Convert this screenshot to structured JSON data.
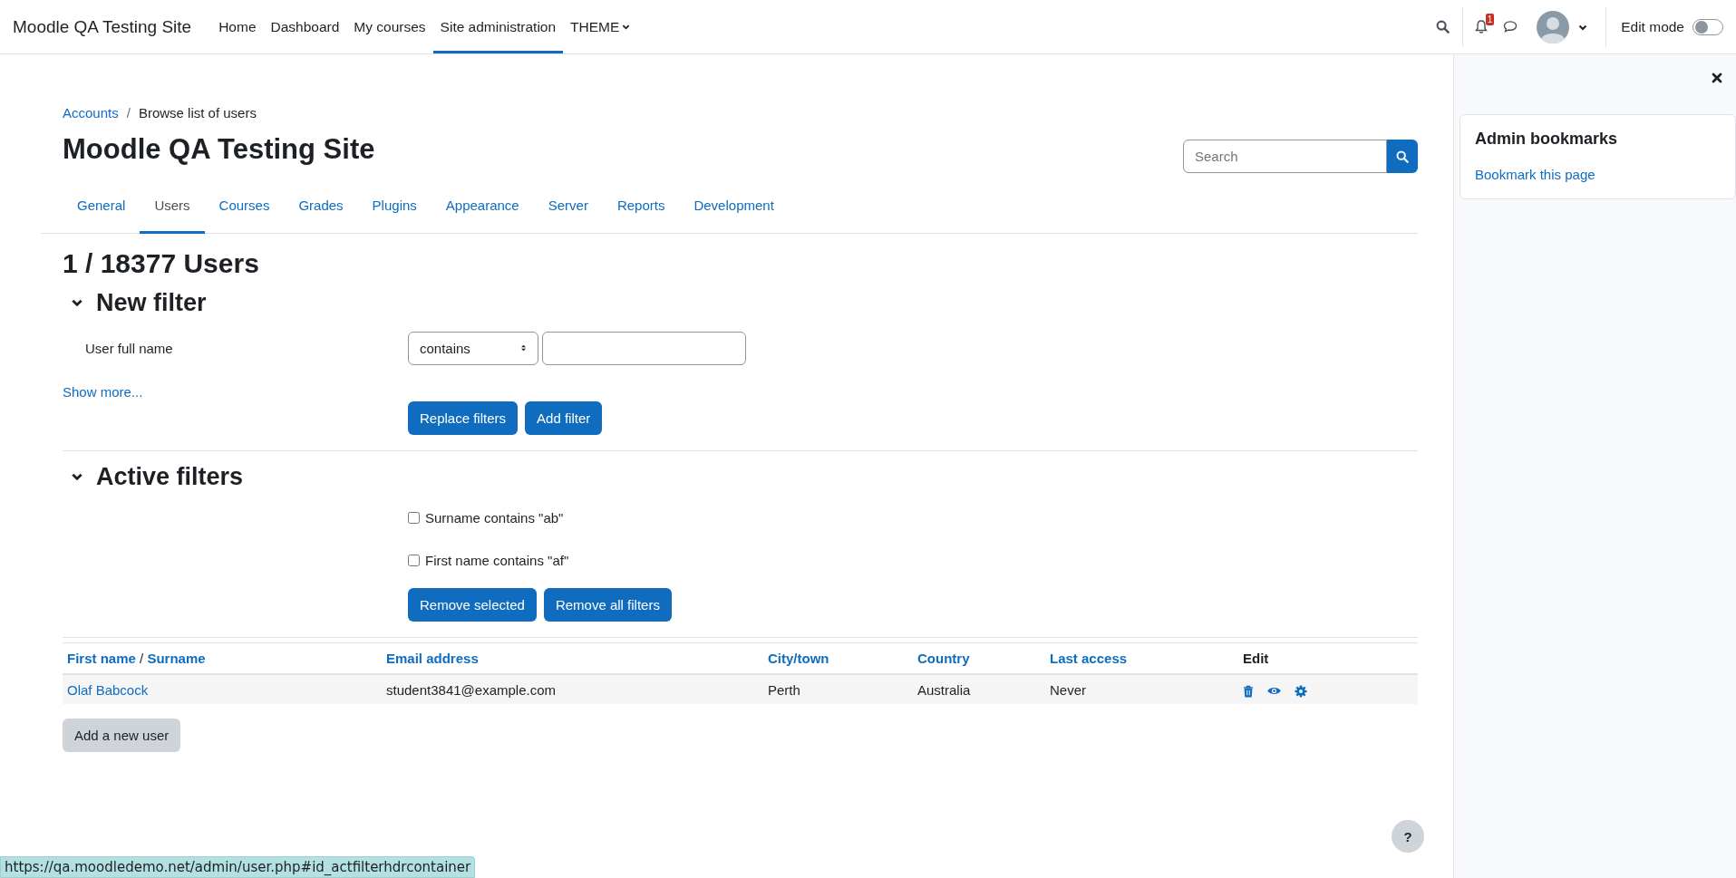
{
  "navbar": {
    "brand": "Moodle QA Testing Site",
    "links": [
      {
        "label": "Home",
        "selected": false,
        "dropdown": false
      },
      {
        "label": "Dashboard",
        "selected": false,
        "dropdown": false
      },
      {
        "label": "My courses",
        "selected": false,
        "dropdown": false
      },
      {
        "label": "Site administration",
        "selected": true,
        "dropdown": false
      },
      {
        "label": "THEME",
        "selected": false,
        "dropdown": true
      }
    ],
    "notification_count": "1",
    "edit_mode": {
      "label": "Edit mode",
      "on": false
    }
  },
  "breadcrumb": {
    "separator": "/",
    "items": [
      {
        "label": "Accounts",
        "link": true
      },
      {
        "label": "Browse list of users",
        "link": false
      }
    ]
  },
  "page_title": "Moodle QA Testing Site",
  "search": {
    "placeholder": "Search"
  },
  "tabs": [
    {
      "label": "General",
      "selected": false
    },
    {
      "label": "Users",
      "selected": true
    },
    {
      "label": "Courses",
      "selected": false
    },
    {
      "label": "Grades",
      "selected": false
    },
    {
      "label": "Plugins",
      "selected": false
    },
    {
      "label": "Appearance",
      "selected": false
    },
    {
      "label": "Server",
      "selected": false
    },
    {
      "label": "Reports",
      "selected": false
    },
    {
      "label": "Development",
      "selected": false
    }
  ],
  "heading": "1 / 18377 Users",
  "new_filter": {
    "title": "New filter",
    "expanded": true,
    "fields": [
      {
        "label": "User full name",
        "operator": "contains"
      }
    ],
    "show_more": "Show more...",
    "buttons": [
      "Replace filters",
      "Add filter"
    ]
  },
  "active_filters": {
    "title": "Active filters",
    "expanded": true,
    "filters": [
      {
        "label": "Surname contains \"ab\"",
        "checked": false
      },
      {
        "label": "First name contains \"af\"",
        "checked": false
      }
    ],
    "buttons": [
      "Remove selected",
      "Remove all filters"
    ]
  },
  "table": {
    "columns": [
      {
        "kind": "pair",
        "labels": [
          "First name",
          "Surname"
        ],
        "separator": "/"
      },
      {
        "kind": "link",
        "label": "Email address"
      },
      {
        "kind": "link",
        "label": "City/town"
      },
      {
        "kind": "link",
        "label": "Country"
      },
      {
        "kind": "link",
        "label": "Last access"
      },
      {
        "kind": "plain",
        "label": "Edit"
      }
    ],
    "rows": [
      {
        "cells": [
          "Olaf Babcock",
          "student3841@example.com",
          "Perth",
          "Australia",
          "Never"
        ]
      }
    ]
  },
  "add_user_button": "Add a new user",
  "drawer": {
    "title": "Admin bookmarks",
    "link": "Bookmark this page"
  },
  "help_button": "?",
  "status_url": "https://qa.moodledemo.net/admin/user.php#id_actfilterhdrcontainer"
}
